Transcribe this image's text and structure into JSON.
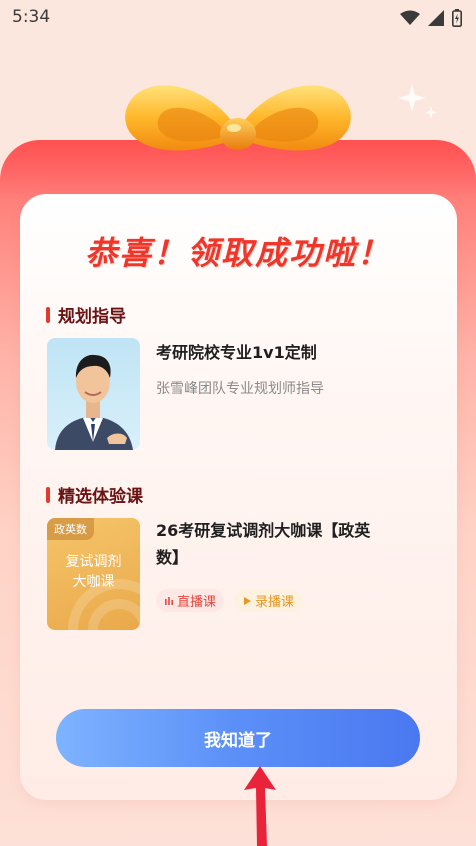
{
  "status_bar": {
    "time": "5:34",
    "icons": [
      "wifi-icon",
      "signal-icon",
      "battery-icon"
    ]
  },
  "dialog": {
    "title": "恭喜！领取成功啦！",
    "planning": {
      "heading": "规划指导",
      "item_title": "考研院校专业1v1定制",
      "item_subtitle": "张雪峰团队专业规划师指导"
    },
    "course": {
      "heading": "精选体验课",
      "item_title_line1": "26考研复试调剂大咖课【政英",
      "item_title_line2": "数】",
      "cover_tag": "政英数",
      "cover_line1": "复试调剂",
      "cover_line2": "大咖课",
      "tag_live": "直播课",
      "tag_recorded": "录播课"
    },
    "confirm_button": "我知道了"
  },
  "colors": {
    "title_red": "#f0352b",
    "section_bar": "#e33a2d",
    "button_blue": "#5b8ff8",
    "arrow_red": "#e8233a"
  }
}
